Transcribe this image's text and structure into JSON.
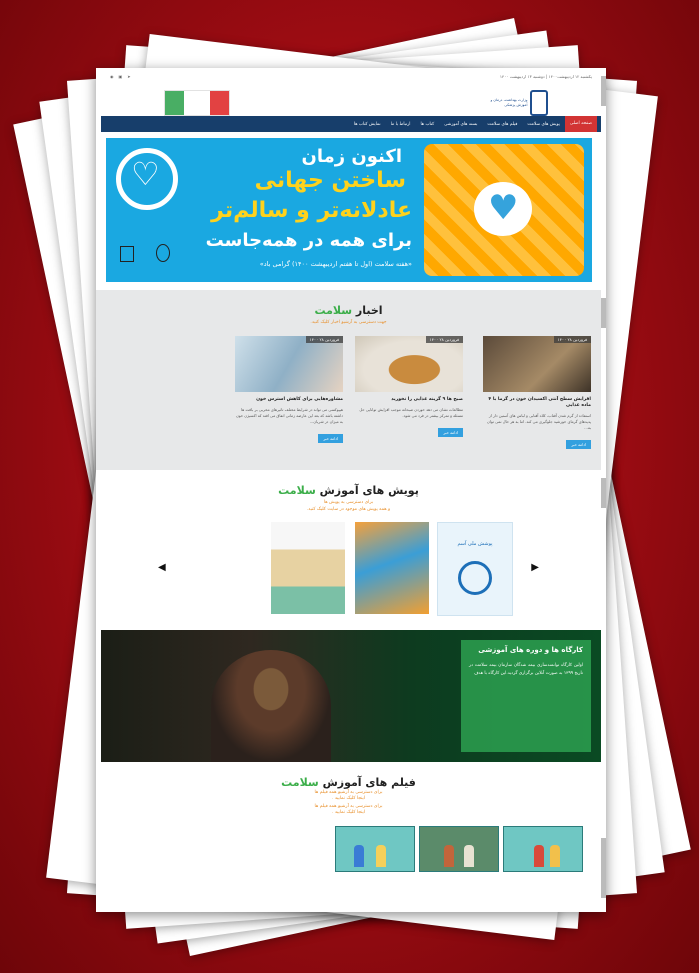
{
  "topbar": {
    "date": "یکشنبه ۱۲ اردیبهشت۱۴۰۰ | دوشنبه ۱۳ اردیبهشت ۱۴۰۰",
    "social": [
      "rss-icon",
      "instagram-icon",
      "telegram-icon"
    ]
  },
  "header": {
    "logo_right_text": "وزارت بهداشت، درمان و آموزش پزشکی",
    "logo_left_text": "انتخابات ۱۴۰۰"
  },
  "nav": {
    "items": [
      "صفحه اصلی",
      "پویش های سلامت",
      "فیلم های سلامت",
      "بسته های آموزشی",
      "کتاب ها",
      "ارتباط با ما",
      "نمایش کتاب ها"
    ]
  },
  "banner": {
    "line1": "اکنون زمان",
    "line2": "ساختن جهانی",
    "line3": "عادلانه‌تر و سالم‌تر",
    "line4": "برای همه در همه‌جاست",
    "line5": "«هفته سلامت (اول تا هفتم اردیبهشت ۱۴۰۰) گرامی باد»"
  },
  "news": {
    "title_a": "اخبار",
    "title_b": "سلامت",
    "subtitle": "جهت دسترسی به آرشیو اخبار کلیک کنید.",
    "cards": [
      {
        "date": "فروردین ۲۸ ۱۴۰۰",
        "title": "افزایش سطح آنتی اکسیدان خون در گرما با ۴ ماده غذایی",
        "text": "استفاده از گرم شدن آفتاب، کلاه آفتابی و لباس های آستین دار از پدیدهای گرمای خورشید جلوگیری می کند. اما به هر حال نمی توان به...",
        "button": "ادامه خبر"
      },
      {
        "date": "فروردین ۲۸ ۱۴۰۰",
        "title": "صبح ها ۹ گزینه غذایی را نخورید",
        "text": "مطالعات نشان می دهد خوردن صبحانه موجب افزایش توانایی حل مسئله و تمرکز بیشتر در فرد می شود.",
        "button": "ادامه خبر"
      },
      {
        "date": "فروردین ۲۸ ۱۴۰۰",
        "title": "مشاوره‌هایی برای کاهش استرس خون",
        "text": "هیپوکسی می تواند در شرایط مختلف تاثیرهای مخربی بر بافت ها داشته باشد که بعد این عارضه زمانی اتفاق می افتد که اکسیژن خون به میزان در شریان...",
        "button": "ادامه خبر"
      }
    ]
  },
  "campaigns": {
    "title_a": "پویش های آموزش",
    "title_b": "سلامت",
    "subtitle1": "برای دسترسی به پویش ها",
    "subtitle2": "و همه پویش های موجود در سایت کلیک کنید.",
    "thumb1_text": "پوشش ملی آسم"
  },
  "workshop": {
    "title": "کارگاه ها و دوره های آموزشی",
    "text": "اولین کارگاه توانمندسازی بیمه شدگان سازمان بیمه سلامت در تاریخ ۱۳۹۹ به صورت آنلاین برگزاری گردید.این کارگاه با هدف"
  },
  "films": {
    "title_a": "فیلم های آموزش",
    "title_b": "سلامت",
    "sub1": "برای دسترسی به آرشیو همه فیلم ها",
    "sub2": "اینجا کلیک نمایید .",
    "sub3": "برای دسترسی به آرشیو همه فیلم ها",
    "sub4": "اینجا کلیک نمایید ."
  },
  "colors": {
    "accent_green": "#3cae4a",
    "nav_blue": "#173e6b",
    "active_red": "#d23434",
    "banner_blue": "#1aa8e1"
  }
}
